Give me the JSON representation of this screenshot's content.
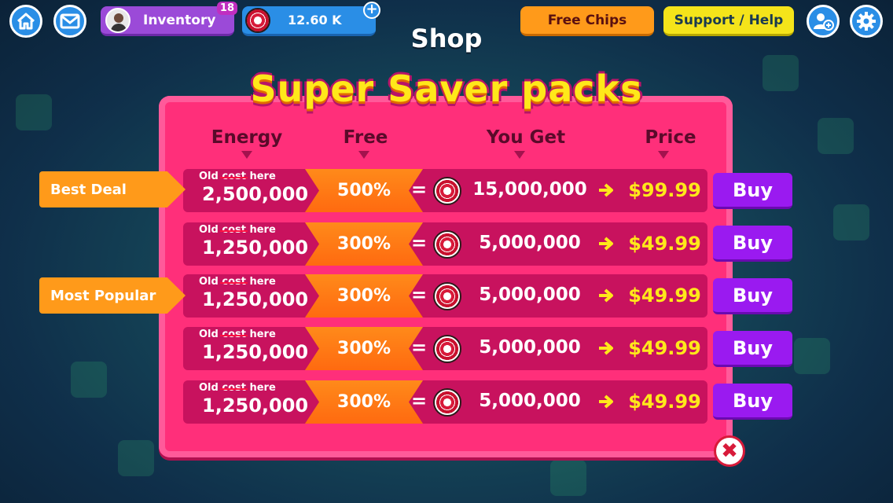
{
  "topbar": {
    "inventory_label": "Inventory",
    "inventory_badge": "18",
    "chips_value": "12.60 K",
    "plus_label": "+",
    "free_chips_label": "Free Chips",
    "support_label": "Support / Help"
  },
  "screen_title": "Shop",
  "panel": {
    "title": "Super Saver packs",
    "headers": {
      "energy": "Energy",
      "free": "Free",
      "you_get": "You Get",
      "price": "Price"
    }
  },
  "tags": {
    "best_deal": "Best Deal",
    "most_popular": "Most Popular"
  },
  "rows": [
    {
      "old_prefix": "Old",
      "old_strike": "cost",
      "old_suffix": "here",
      "energy": "2,500,000",
      "free": "500%",
      "equals": "=",
      "get": "15,000,000",
      "price": "$99.99",
      "buy": "Buy"
    },
    {
      "old_prefix": "Old",
      "old_strike": "cost",
      "old_suffix": "here",
      "energy": "1,250,000",
      "free": "300%",
      "equals": "=",
      "get": "5,000,000",
      "price": "$49.99",
      "buy": "Buy"
    },
    {
      "old_prefix": "Old",
      "old_strike": "cost",
      "old_suffix": "here",
      "energy": "1,250,000",
      "free": "300%",
      "equals": "=",
      "get": "5,000,000",
      "price": "$49.99",
      "buy": "Buy"
    },
    {
      "old_prefix": "Old",
      "old_strike": "cost",
      "old_suffix": "here",
      "energy": "1,250,000",
      "free": "300%",
      "equals": "=",
      "get": "5,000,000",
      "price": "$49.99",
      "buy": "Buy"
    },
    {
      "old_prefix": "Old",
      "old_strike": "cost",
      "old_suffix": "here",
      "energy": "1,250,000",
      "free": "300%",
      "equals": "=",
      "get": "5,000,000",
      "price": "$49.99",
      "buy": "Buy"
    }
  ],
  "close_label": "✖",
  "icons": {
    "home": "home-icon",
    "mail": "mail-icon",
    "add_friend": "add-friend-icon",
    "settings": "gear-icon",
    "chip": "poker-chip-icon"
  },
  "colors": {
    "panel": "#ff2f7a",
    "row": "#c8125e",
    "free_box": "#ff7a14",
    "price": "#ffe81a",
    "buy": "#9a1af0",
    "tag": "#ff9a1a",
    "topbar_blue": "#2a8ee6",
    "inventory_purple": "#9b4ad8",
    "support_yellow": "#f4e41a"
  }
}
